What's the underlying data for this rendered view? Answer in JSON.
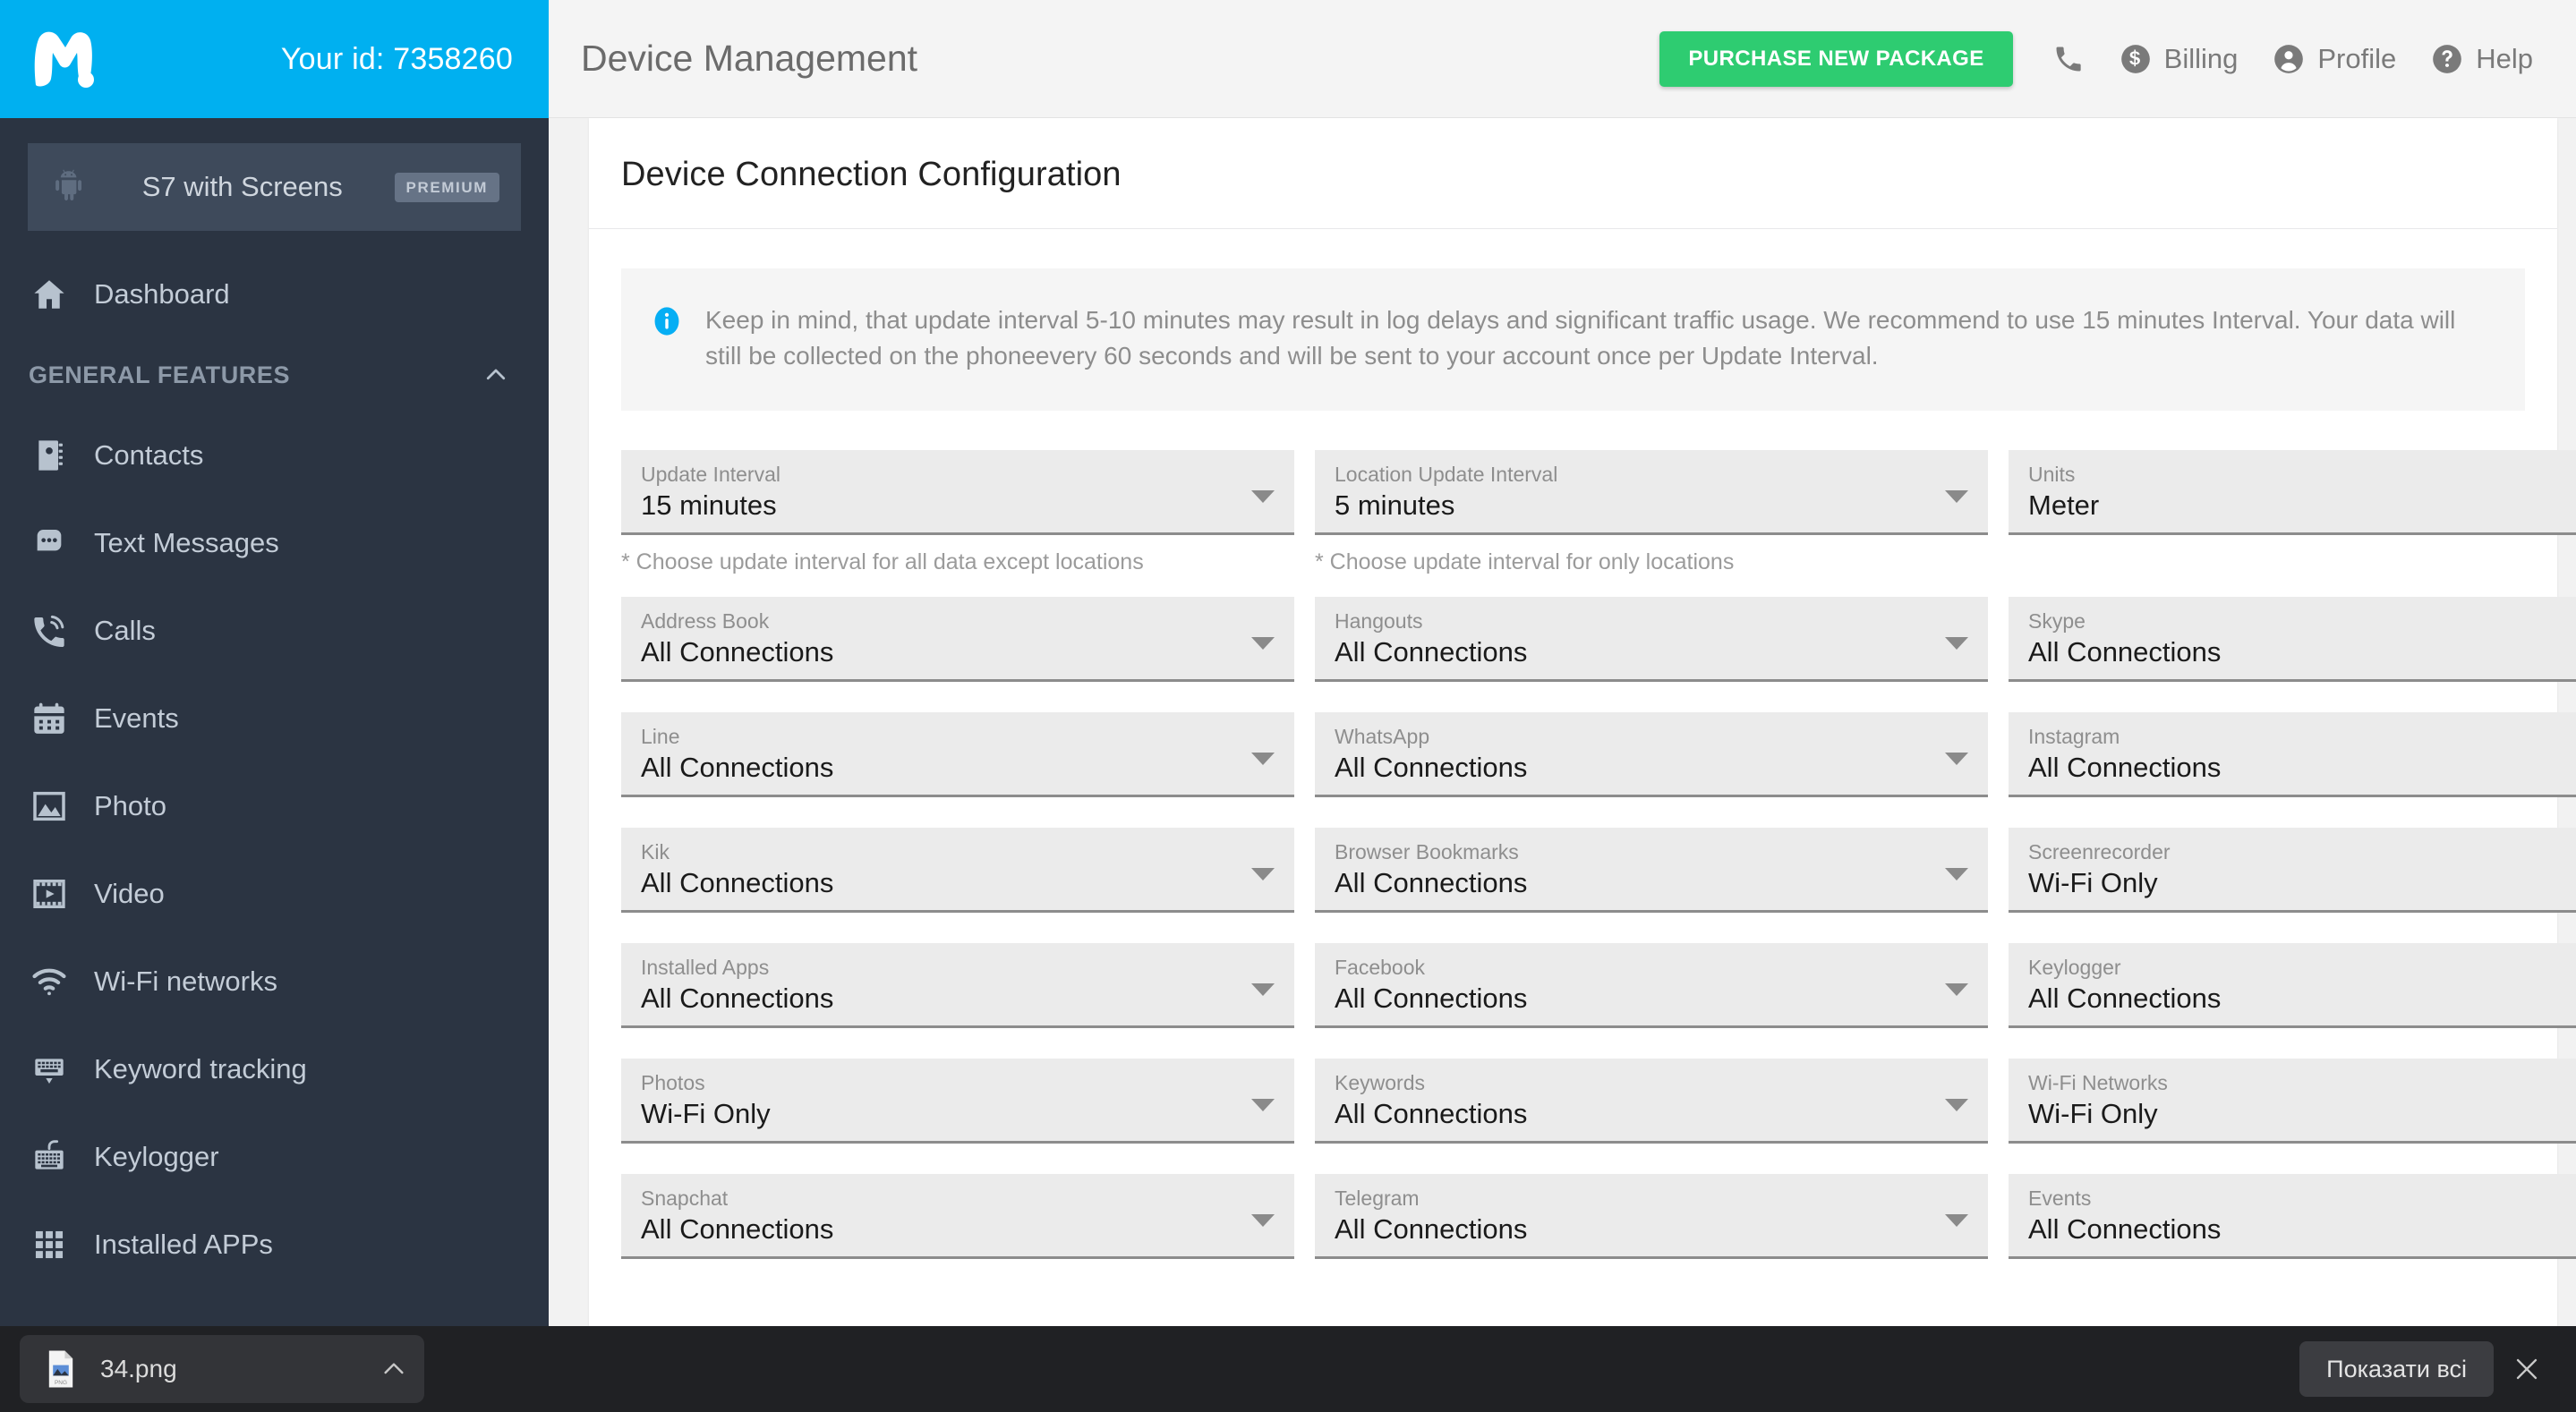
{
  "topbar": {
    "account_id_label": "Your id: 7358260",
    "page_title": "Device Management",
    "purchase_button": "PURCHASE NEW PACKAGE",
    "links": [
      {
        "label": "",
        "icon": "phone-icon"
      },
      {
        "label": "Billing",
        "icon": "dollar-icon"
      },
      {
        "label": "Profile",
        "icon": "person-icon"
      },
      {
        "label": "Help",
        "icon": "question-icon"
      }
    ],
    "brand_color": "#00b0f0",
    "purchase_color": "#2ecc71"
  },
  "sidebar": {
    "device": {
      "name": "S7 with Screens",
      "badge": "PREMIUM",
      "icon": "android-icon"
    },
    "dashboard": {
      "label": "Dashboard",
      "icon": "home-icon"
    },
    "section": {
      "label": "GENERAL FEATURES",
      "icon": "chevron-up-icon"
    },
    "items": [
      {
        "label": "Contacts",
        "icon": "address-book-icon"
      },
      {
        "label": "Text Messages",
        "icon": "message-bubble-icon"
      },
      {
        "label": "Calls",
        "icon": "phone-call-icon"
      },
      {
        "label": "Events",
        "icon": "calendar-icon"
      },
      {
        "label": "Photo",
        "icon": "image-icon"
      },
      {
        "label": "Video",
        "icon": "film-icon"
      },
      {
        "label": "Wi-Fi networks",
        "icon": "wifi-icon"
      },
      {
        "label": "Keyword tracking",
        "icon": "keyboard-down-icon"
      },
      {
        "label": "Keylogger",
        "icon": "keyboard-icon"
      },
      {
        "label": "Installed APPs",
        "icon": "grid-apps-icon"
      }
    ]
  },
  "main": {
    "heading": "Device Connection Configuration",
    "notice": {
      "icon": "info-icon",
      "text": "Keep in mind, that update interval 5-10 minutes may result in log delays and significant traffic usage. We recommend to use 15 minutes Interval. Your data will still be collected on the phoneevery 60 seconds and will be sent to your account once per Update Interval."
    },
    "fields_row1": [
      {
        "label": "Update Interval",
        "value": "15 minutes",
        "hint": "* Choose update interval for all data except locations"
      },
      {
        "label": "Location Update Interval",
        "value": "5 minutes",
        "hint": "* Choose update interval for only locations"
      },
      {
        "label": "Units",
        "value": "Meter",
        "hint": ""
      }
    ],
    "fields_grid": [
      {
        "label": "Address Book",
        "value": "All Connections"
      },
      {
        "label": "Hangouts",
        "value": "All Connections"
      },
      {
        "label": "Skype",
        "value": "All Connections"
      },
      {
        "label": "Line",
        "value": "All Connections"
      },
      {
        "label": "WhatsApp",
        "value": "All Connections"
      },
      {
        "label": "Instagram",
        "value": "All Connections"
      },
      {
        "label": "Kik",
        "value": "All Connections"
      },
      {
        "label": "Browser Bookmarks",
        "value": "All Connections"
      },
      {
        "label": "Screenrecorder",
        "value": "Wi-Fi Only"
      },
      {
        "label": "Installed Apps",
        "value": "All Connections"
      },
      {
        "label": "Facebook",
        "value": "All Connections"
      },
      {
        "label": "Keylogger",
        "value": "All Connections"
      },
      {
        "label": "Photos",
        "value": "Wi-Fi Only"
      },
      {
        "label": "Keywords",
        "value": "All Connections"
      },
      {
        "label": "Wi-Fi Networks",
        "value": "Wi-Fi Only"
      },
      {
        "label": "Snapchat",
        "value": "All Connections"
      },
      {
        "label": "Telegram",
        "value": "All Connections"
      },
      {
        "label": "Events",
        "value": "All Connections"
      }
    ]
  },
  "downloadbar": {
    "file_name": "34.png",
    "file_icon": "png-file-icon",
    "expand_icon": "chevron-up-icon",
    "show_all_button": "Показати всі",
    "close_icon": "close-icon"
  }
}
